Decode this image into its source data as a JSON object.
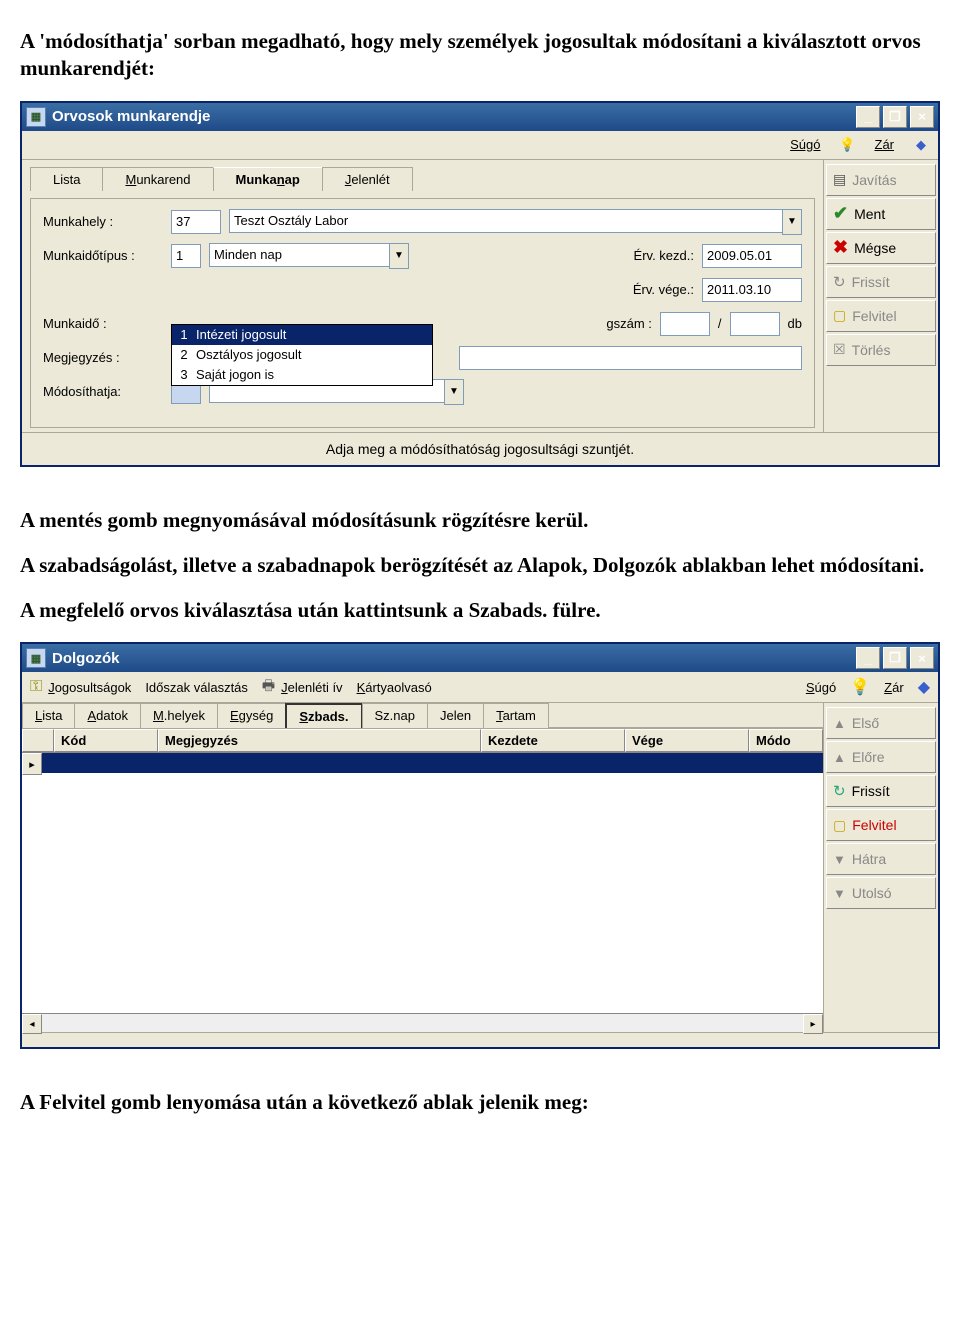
{
  "p1": "A 'módosíthatja' sorban megadható, hogy mely személyek jogosultak módosítani a kiválasztott orvos munkarendjét:",
  "p2": "A mentés gomb megnyomásával módosításunk rögzítésre kerül.",
  "p3": "A szabadságolást, illetve a szabadnapok berögzítését az Alapok, Dolgozók ablakban lehet módosítani.",
  "p4": "A megfelelő orvos kiválasztása után kattintsunk a Szabads. fülre.",
  "p5": "A Felvitel gomb lenyomása után a következő ablak jelenik meg:",
  "win1": {
    "title": "Orvosok munkarendje",
    "menu": {
      "sugo": "Súgó",
      "zar": "Zár"
    },
    "tabs": {
      "lista": "Lista",
      "munkarend": "Munkarend",
      "munkanap": "Munkanap",
      "jelenlet": "Jelenlét"
    },
    "labels": {
      "munkahely": "Munkahely :",
      "munkaidotipus": "Munkaidőtípus :",
      "ervkezd": "Érv. kezd.:",
      "ervvege": "Érv. vége.:",
      "munkaido": "Munkaidő :",
      "gszam": "gszám :",
      "per": "/",
      "db": "db",
      "megjegyzes": "Megjegyzés :",
      "modosithatja": "Módosíthatja:"
    },
    "values": {
      "munkahely_kod": "37",
      "munkahely_nev": "Teszt Osztály Labor",
      "munkaidotipus_kod": "1",
      "munkaidotipus_nev": "Minden nap",
      "ervkezd": "2009.05.01",
      "ervvege": "2011.03.10"
    },
    "dropdown": [
      {
        "n": "1",
        "t": "Intézeti jogosult"
      },
      {
        "n": "2",
        "t": "Osztályos jogosult"
      },
      {
        "n": "3",
        "t": "Saját jogon is"
      }
    ],
    "side": {
      "javitas": "Javítás",
      "ment": "Ment",
      "megse": "Mégse",
      "frissit": "Frissít",
      "felvitel": "Felvitel",
      "torles": "Törlés"
    },
    "status": "Adja meg  a módósíthatóság jogosultsági szuntjét."
  },
  "win2": {
    "title": "Dolgozók",
    "toolbar": {
      "jogosultsagok": "Jogosultságok",
      "idoszak": "Időszak választás",
      "jelenleti": "Jelenléti ív",
      "kartya": "Kártyaolvasó",
      "sugo": "Súgó",
      "zar": "Zár"
    },
    "tabs": {
      "lista": "Lista",
      "adatok": "Adatok",
      "mhelyek": "M.helyek",
      "egyseg": "Egység",
      "szbads": "Szbads.",
      "sznap": "Sz.nap",
      "jelen": "Jelen",
      "tartam": "Tartam"
    },
    "cols": {
      "kod": "Kód",
      "megj": "Megjegyzés",
      "kezdete": "Kezdete",
      "vege": "Vége",
      "mod": "Módo"
    },
    "side": {
      "elso": "Első",
      "elore": "Előre",
      "frissit": "Frissít",
      "felvitel": "Felvitel",
      "hatra": "Hátra",
      "utolso": "Utolsó"
    }
  }
}
